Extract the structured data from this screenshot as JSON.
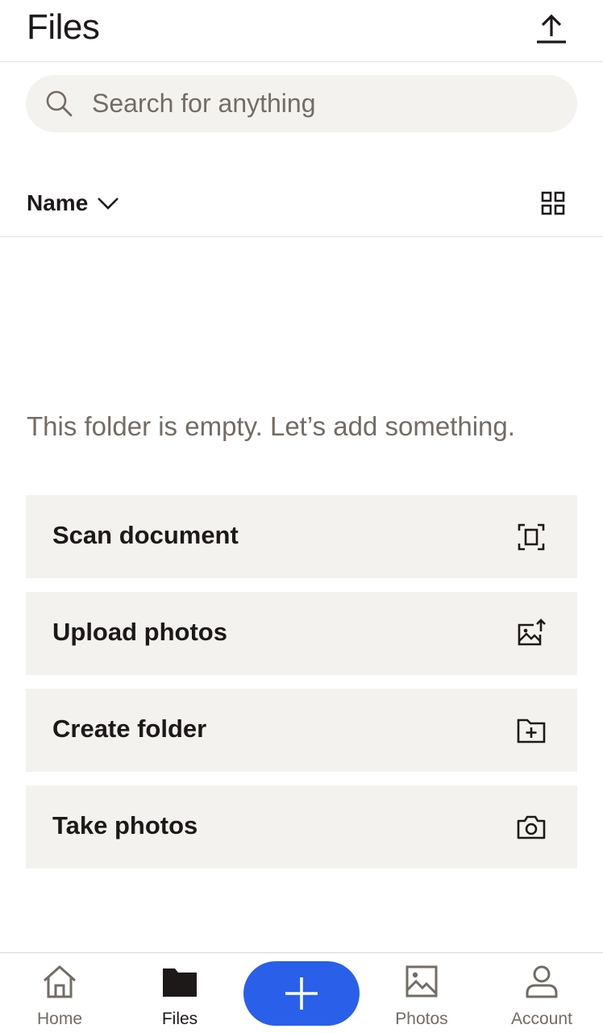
{
  "header": {
    "title": "Files",
    "upload_icon": "upload-icon"
  },
  "search": {
    "placeholder": "Search for anything",
    "value": "",
    "icon": "search-icon"
  },
  "sort": {
    "label": "Name",
    "chevron_icon": "chevron-down-icon",
    "view_icon": "grid-view-icon"
  },
  "empty_state": {
    "message": "This folder is empty. Let’s add something."
  },
  "actions": [
    {
      "label": "Scan document",
      "icon": "scan-document-icon"
    },
    {
      "label": "Upload photos",
      "icon": "upload-photo-icon"
    },
    {
      "label": "Create folder",
      "icon": "create-folder-icon"
    },
    {
      "label": "Take photos",
      "icon": "camera-icon"
    }
  ],
  "bottom_nav": {
    "items": [
      {
        "label": "Home",
        "icon": "home-icon",
        "active": false
      },
      {
        "label": "Files",
        "icon": "folder-icon",
        "active": true
      },
      {
        "label": "Photos",
        "icon": "photos-icon",
        "active": false
      },
      {
        "label": "Account",
        "icon": "account-icon",
        "active": false
      }
    ],
    "fab_icon": "plus-icon"
  },
  "colors": {
    "text": "#1e1919",
    "muted_text": "#736c64",
    "surface": "#f4f2ef",
    "divider": "#e3e1de",
    "accent": "#2a5fea"
  }
}
